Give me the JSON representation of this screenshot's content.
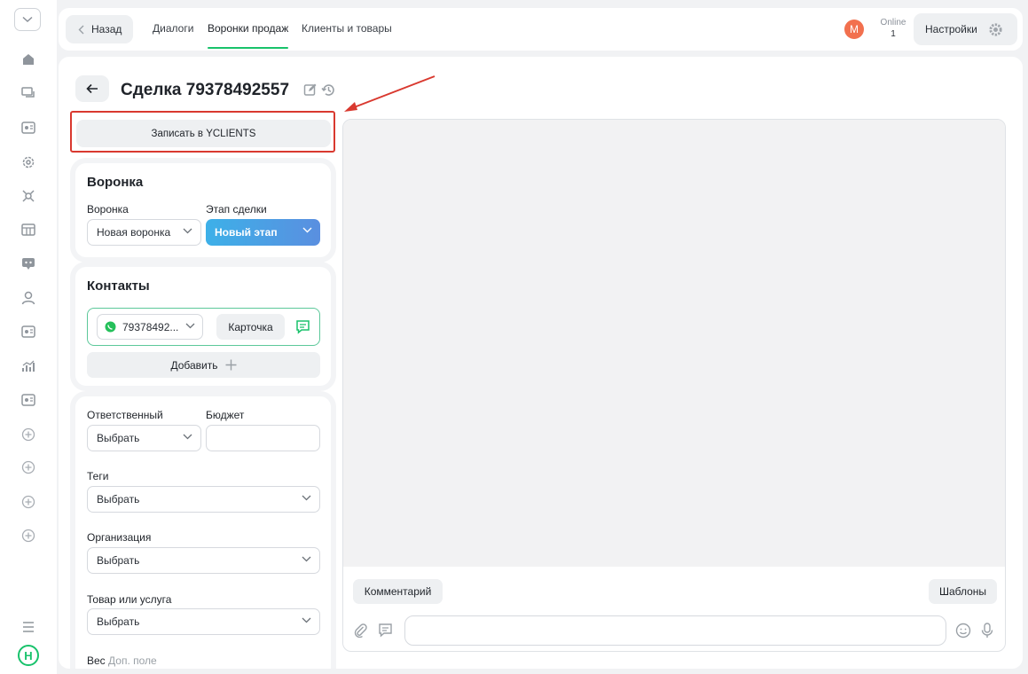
{
  "header": {
    "back_label": "Назад",
    "tabs": [
      {
        "label": "Диалоги"
      },
      {
        "label": "Воронки продаж"
      },
      {
        "label": "Клиенты и товары"
      }
    ],
    "avatar_letter": "M",
    "online_label": "Online",
    "online_count": "1",
    "settings_label": "Настройки"
  },
  "sidebar": {
    "icons": [
      "home-icon",
      "chats-icon",
      "contact-card-icon",
      "gear-icon",
      "integrations-icon",
      "table-icon",
      "bot-icon",
      "user-icon",
      "contact-card-icon",
      "analytics-icon",
      "contact-card-icon",
      "add-icon",
      "add-icon",
      "add-icon",
      "add-icon",
      "menu-icon"
    ],
    "logo_letter": "H"
  },
  "deal": {
    "title": "Сделка 79378492557",
    "record_button": "Записать в YCLIENTS"
  },
  "funnel": {
    "title": "Воронка",
    "funnel_label": "Воронка",
    "funnel_value": "Новая воронка",
    "stage_label": "Этап сделки",
    "stage_value": "Новый этап"
  },
  "contacts": {
    "title": "Контакты",
    "phone": "79378492...",
    "card_button": "Карточка",
    "add_button": "Добавить"
  },
  "details": {
    "responsible_label": "Ответственный",
    "responsible_value": "Выбрать",
    "budget_label": "Бюджет",
    "budget_value": "",
    "tags_label": "Теги",
    "tags_value": "Выбрать",
    "org_label": "Организация",
    "org_value": "Выбрать",
    "product_label": "Товар или услуга",
    "product_value": "Выбрать",
    "weight_label": "Вес",
    "weight_hint": "Доп. поле"
  },
  "chat": {
    "comment_button": "Комментарий",
    "templates_button": "Шаблоны",
    "message_value": ""
  },
  "colors": {
    "accent_green": "#18c26b",
    "highlight_red": "#d9392f",
    "stage_blue": "#3db0e8",
    "avatar_orange": "#f2704e"
  }
}
